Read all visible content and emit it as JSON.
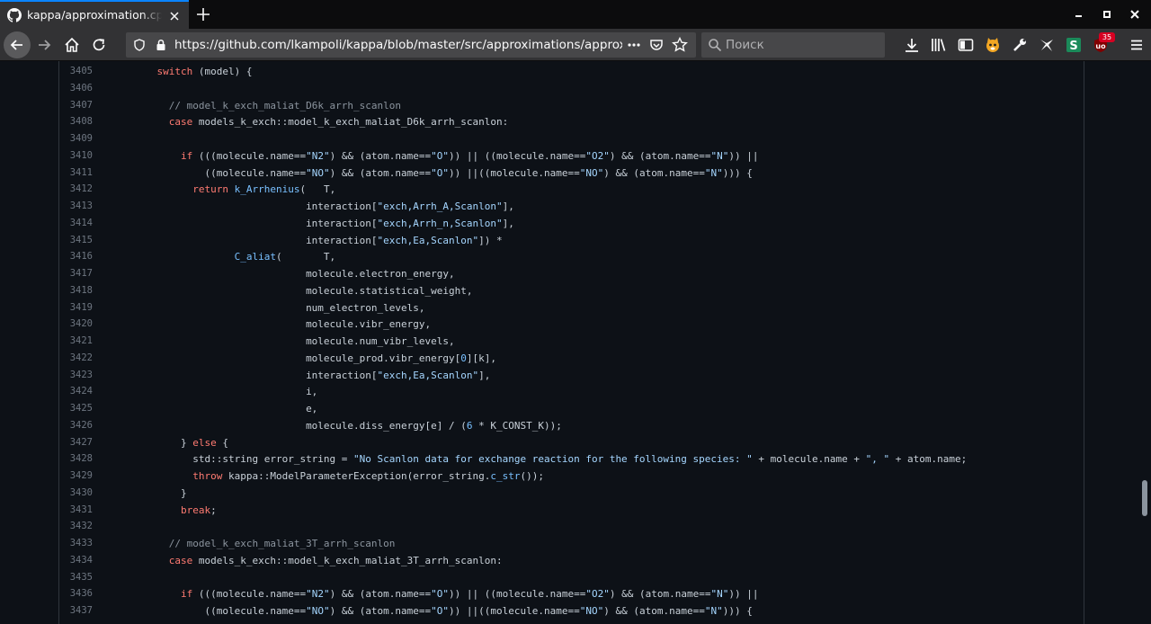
{
  "tab": {
    "title": "kappa/approximation.cpp at master · lkampoli/kappa",
    "favicon": "github-icon"
  },
  "nav": {
    "url": "https://github.com/lkampoli/kappa/blob/master/src/approximations/approximation.cpp",
    "search_placeholder": "Поиск",
    "extension_badge": "35"
  },
  "code": {
    "language": "C++",
    "lines": [
      {
        "n": "3405",
        "indent": "    ",
        "tokens": [
          {
            "t": "switch",
            "c": "kw"
          },
          {
            "t": " (model) {"
          }
        ]
      },
      {
        "n": "3406",
        "indent": "",
        "tokens": []
      },
      {
        "n": "3407",
        "indent": "      ",
        "tokens": [
          {
            "t": "// model_k_exch_maliat_D6k_arrh_scanlon",
            "c": "cmt"
          }
        ]
      },
      {
        "n": "3408",
        "indent": "      ",
        "tokens": [
          {
            "t": "case",
            "c": "kw"
          },
          {
            "t": " models_k_exch::model_k_exch_maliat_D6k_arrh_scanlon:"
          }
        ]
      },
      {
        "n": "3409",
        "indent": "",
        "tokens": []
      },
      {
        "n": "3410",
        "indent": "        ",
        "tokens": [
          {
            "t": "if",
            "c": "kw"
          },
          {
            "t": " (((molecule.name=="
          },
          {
            "t": "\"N2\"",
            "c": "str"
          },
          {
            "t": ") && (atom.name=="
          },
          {
            "t": "\"O\"",
            "c": "str"
          },
          {
            "t": ")) || ((molecule.name=="
          },
          {
            "t": "\"O2\"",
            "c": "str"
          },
          {
            "t": ") && (atom.name=="
          },
          {
            "t": "\"N\"",
            "c": "str"
          },
          {
            "t": ")) ||"
          }
        ]
      },
      {
        "n": "3411",
        "indent": "            ",
        "tokens": [
          {
            "t": "((molecule.name=="
          },
          {
            "t": "\"NO\"",
            "c": "str"
          },
          {
            "t": ") && (atom.name=="
          },
          {
            "t": "\"O\"",
            "c": "str"
          },
          {
            "t": ")) ||((molecule.name=="
          },
          {
            "t": "\"NO\"",
            "c": "str"
          },
          {
            "t": ") && (atom.name=="
          },
          {
            "t": "\"N\"",
            "c": "str"
          },
          {
            "t": "))) {"
          }
        ]
      },
      {
        "n": "3412",
        "indent": "          ",
        "tokens": [
          {
            "t": "return",
            "c": "kw"
          },
          {
            "t": " "
          },
          {
            "t": "k_Arrhenius",
            "c": "fn"
          },
          {
            "t": "(   T,"
          }
        ]
      },
      {
        "n": "3413",
        "indent": "                             ",
        "tokens": [
          {
            "t": "interaction["
          },
          {
            "t": "\"exch,Arrh_A,Scanlon\"",
            "c": "str"
          },
          {
            "t": "],"
          }
        ]
      },
      {
        "n": "3414",
        "indent": "                             ",
        "tokens": [
          {
            "t": "interaction["
          },
          {
            "t": "\"exch,Arrh_n,Scanlon\"",
            "c": "str"
          },
          {
            "t": "],"
          }
        ]
      },
      {
        "n": "3415",
        "indent": "                             ",
        "tokens": [
          {
            "t": "interaction["
          },
          {
            "t": "\"exch,Ea,Scanlon\"",
            "c": "str"
          },
          {
            "t": "]) *"
          }
        ]
      },
      {
        "n": "3416",
        "indent": "                 ",
        "tokens": [
          {
            "t": "C_aliat",
            "c": "fn"
          },
          {
            "t": "(       T,"
          }
        ]
      },
      {
        "n": "3417",
        "indent": "                             ",
        "tokens": [
          {
            "t": "molecule.electron_energy,"
          }
        ]
      },
      {
        "n": "3418",
        "indent": "                             ",
        "tokens": [
          {
            "t": "molecule.statistical_weight,"
          }
        ]
      },
      {
        "n": "3419",
        "indent": "                             ",
        "tokens": [
          {
            "t": "num_electron_levels,"
          }
        ]
      },
      {
        "n": "3420",
        "indent": "                             ",
        "tokens": [
          {
            "t": "molecule.vibr_energy,"
          }
        ]
      },
      {
        "n": "3421",
        "indent": "                             ",
        "tokens": [
          {
            "t": "molecule.num_vibr_levels,"
          }
        ]
      },
      {
        "n": "3422",
        "indent": "                             ",
        "tokens": [
          {
            "t": "molecule_prod.vibr_energy["
          },
          {
            "t": "0",
            "c": "fn"
          },
          {
            "t": "][k],"
          }
        ]
      },
      {
        "n": "3423",
        "indent": "                             ",
        "tokens": [
          {
            "t": "interaction["
          },
          {
            "t": "\"exch,Ea,Scanlon\"",
            "c": "str"
          },
          {
            "t": "],"
          }
        ]
      },
      {
        "n": "3424",
        "indent": "                             ",
        "tokens": [
          {
            "t": "i,"
          }
        ]
      },
      {
        "n": "3425",
        "indent": "                             ",
        "tokens": [
          {
            "t": "e,"
          }
        ]
      },
      {
        "n": "3426",
        "indent": "                             ",
        "tokens": [
          {
            "t": "molecule.diss_energy[e] / ("
          },
          {
            "t": "6",
            "c": "fn"
          },
          {
            "t": " * K_CONST_K));"
          }
        ]
      },
      {
        "n": "3427",
        "indent": "        ",
        "tokens": [
          {
            "t": "} "
          },
          {
            "t": "else",
            "c": "kw"
          },
          {
            "t": " {"
          }
        ]
      },
      {
        "n": "3428",
        "indent": "          ",
        "tokens": [
          {
            "t": "std::string error_string = "
          },
          {
            "t": "\"No Scanlon data for exchange reaction for the following species: \"",
            "c": "str"
          },
          {
            "t": " + molecule.name + "
          },
          {
            "t": "\", \"",
            "c": "str"
          },
          {
            "t": " + atom.name;"
          }
        ]
      },
      {
        "n": "3429",
        "indent": "          ",
        "tokens": [
          {
            "t": "throw",
            "c": "kw"
          },
          {
            "t": " kappa::ModelParameterException(error_string."
          },
          {
            "t": "c_str",
            "c": "fn"
          },
          {
            "t": "());"
          }
        ]
      },
      {
        "n": "3430",
        "indent": "        ",
        "tokens": [
          {
            "t": "}"
          }
        ]
      },
      {
        "n": "3431",
        "indent": "        ",
        "tokens": [
          {
            "t": "break",
            "c": "kw"
          },
          {
            "t": ";"
          }
        ]
      },
      {
        "n": "3432",
        "indent": "",
        "tokens": []
      },
      {
        "n": "3433",
        "indent": "      ",
        "tokens": [
          {
            "t": "// model_k_exch_maliat_3T_arrh_scanlon",
            "c": "cmt"
          }
        ]
      },
      {
        "n": "3434",
        "indent": "      ",
        "tokens": [
          {
            "t": "case",
            "c": "kw"
          },
          {
            "t": " models_k_exch::model_k_exch_maliat_3T_arrh_scanlon:"
          }
        ]
      },
      {
        "n": "3435",
        "indent": "",
        "tokens": []
      },
      {
        "n": "3436",
        "indent": "        ",
        "tokens": [
          {
            "t": "if",
            "c": "kw"
          },
          {
            "t": " (((molecule.name=="
          },
          {
            "t": "\"N2\"",
            "c": "str"
          },
          {
            "t": ") && (atom.name=="
          },
          {
            "t": "\"O\"",
            "c": "str"
          },
          {
            "t": ")) || ((molecule.name=="
          },
          {
            "t": "\"O2\"",
            "c": "str"
          },
          {
            "t": ") && (atom.name=="
          },
          {
            "t": "\"N\"",
            "c": "str"
          },
          {
            "t": ")) ||"
          }
        ]
      },
      {
        "n": "3437",
        "indent": "            ",
        "tokens": [
          {
            "t": "((molecule.name=="
          },
          {
            "t": "\"NO\"",
            "c": "str"
          },
          {
            "t": ") && (atom.name=="
          },
          {
            "t": "\"O\"",
            "c": "str"
          },
          {
            "t": ")) ||((molecule.name=="
          },
          {
            "t": "\"NO\"",
            "c": "str"
          },
          {
            "t": ") && (atom.name=="
          },
          {
            "t": "\"N\"",
            "c": "str"
          },
          {
            "t": "))) {"
          }
        ]
      }
    ]
  },
  "colors": {
    "keyword": "#ff7b72",
    "string": "#a5d6ff",
    "comment": "#8b949e",
    "function": "#79c0ff",
    "text": "#c9d1d9",
    "background": "#0d1117"
  }
}
